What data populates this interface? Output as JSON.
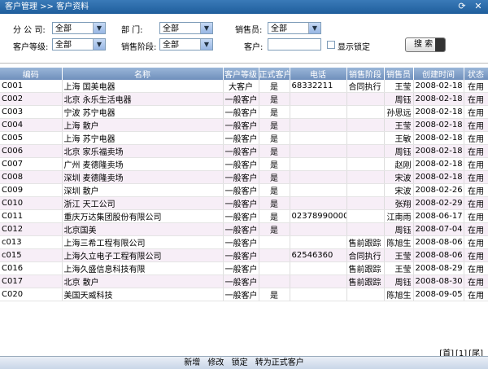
{
  "titlebar": {
    "crumb": "客户管理 >> 客户资料"
  },
  "filters": {
    "company_label": "分 公 司:",
    "company_value": "全部",
    "department_label": "部    门:",
    "department_value": "全部",
    "salesperson_label": "销售员:",
    "salesperson_value": "全部",
    "level_label": "客户等级:",
    "level_value": "全部",
    "stage_label": "销售阶段:",
    "stage_value": "全部",
    "customer_label": "客户:",
    "customer_value": "",
    "show_locked_label": "显示锁定",
    "search_label": "搜 索"
  },
  "table": {
    "headers": [
      "编码",
      "名称",
      "客户等级",
      "正式客户",
      "电话",
      "销售阶段",
      "销售员",
      "创建时间",
      "状态"
    ],
    "rows": [
      [
        "C001",
        "上海 国美电器",
        "大客户",
        "是",
        "68332211",
        "合同执行",
        "王莹",
        "2008-02-18",
        "在用"
      ],
      [
        "C002",
        "北京 永乐生活电器",
        "一般客户",
        "是",
        "",
        "",
        "周钰",
        "2008-02-18",
        "在用"
      ],
      [
        "C003",
        "宁波 苏宁电器",
        "一般客户",
        "是",
        "",
        "",
        "孙思远",
        "2008-02-18",
        "在用"
      ],
      [
        "C004",
        "上海 散户",
        "一般客户",
        "是",
        "",
        "",
        "王莹",
        "2008-02-18",
        "在用"
      ],
      [
        "C005",
        "上海 苏宁电器",
        "一般客户",
        "是",
        "",
        "",
        "王敏",
        "2008-02-18",
        "在用"
      ],
      [
        "C006",
        "北京 家乐福卖场",
        "一般客户",
        "是",
        "",
        "",
        "周钰",
        "2008-02-18",
        "在用"
      ],
      [
        "C007",
        "广州 麦德隆卖场",
        "一般客户",
        "是",
        "",
        "",
        "赵刚",
        "2008-02-18",
        "在用"
      ],
      [
        "C008",
        "深圳 麦德隆卖场",
        "一般客户",
        "是",
        "",
        "",
        "宋波",
        "2008-02-18",
        "在用"
      ],
      [
        "C009",
        "深圳 散户",
        "一般客户",
        "是",
        "",
        "",
        "宋波",
        "2008-02-26",
        "在用"
      ],
      [
        "C010",
        "浙江 天工公司",
        "一般客户",
        "是",
        "",
        "",
        "张翔",
        "2008-02-29",
        "在用"
      ],
      [
        "C011",
        "重庆万达集团股份有限公司",
        "一般客户",
        "是",
        "02378990000",
        "",
        "江南雨",
        "2008-06-17",
        "在用"
      ],
      [
        "C012",
        "北京国美",
        "一般客户",
        "是",
        "",
        "",
        "周钰",
        "2008-07-04",
        "在用"
      ],
      [
        "c013",
        "上海三希工程有限公司",
        "一般客户",
        "",
        "",
        "售前跟踪",
        "陈旭生",
        "2008-08-06",
        "在用"
      ],
      [
        "c015",
        "上海久立电子工程有限公司",
        "一般客户",
        "",
        "62546360",
        "合同执行",
        "王莹",
        "2008-08-06",
        "在用"
      ],
      [
        "C016",
        "上海久盛信息科技有限",
        "一般客户",
        "",
        "",
        "售前跟踪",
        "王莹",
        "2008-08-29",
        "在用"
      ],
      [
        "C017",
        "北京 散户",
        "一般客户",
        "",
        "",
        "售前跟踪",
        "周钰",
        "2008-08-30",
        "在用"
      ],
      [
        "C020",
        "美国天威科技",
        "一般客户",
        "是",
        "",
        "",
        "陈旭生",
        "2008-09-05",
        "在用"
      ]
    ]
  },
  "pager": {
    "first": "[首]",
    "current": "[1]",
    "last": "[尾]"
  },
  "bottombar": {
    "new": "新增",
    "edit": "修改",
    "lock": "锁定",
    "convert": "转为正式客户"
  },
  "icons": {
    "refresh": "refresh-icon",
    "close": "close-icon"
  }
}
